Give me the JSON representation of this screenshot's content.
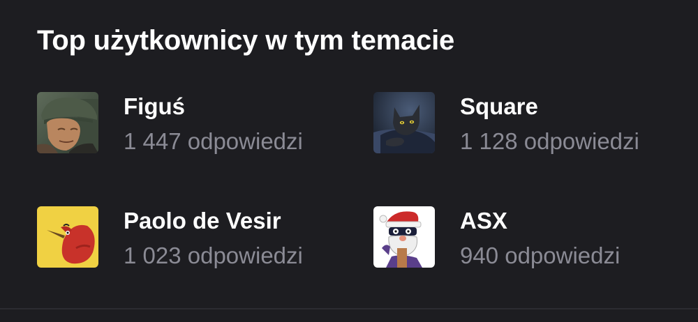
{
  "section": {
    "title": "Top użytkownicy w tym temacie"
  },
  "users": [
    {
      "name": "Figuś",
      "replies": "1 447 odpowiedzi",
      "avatar": "man-with-cap-avatar"
    },
    {
      "name": "Square",
      "replies": "1 128 odpowiedzi",
      "avatar": "black-cat-avatar"
    },
    {
      "name": "Paolo de Vesir",
      "replies": "1 023 odpowiedzi",
      "avatar": "red-bird-avatar"
    },
    {
      "name": "ASX",
      "replies": "940 odpowiedzi",
      "avatar": "cartoon-santa-avatar"
    }
  ],
  "colors": {
    "background": "#1d1d21",
    "name_text": "#ffffff",
    "count_text": "#8b8b95",
    "divider": "#2b2b31"
  }
}
